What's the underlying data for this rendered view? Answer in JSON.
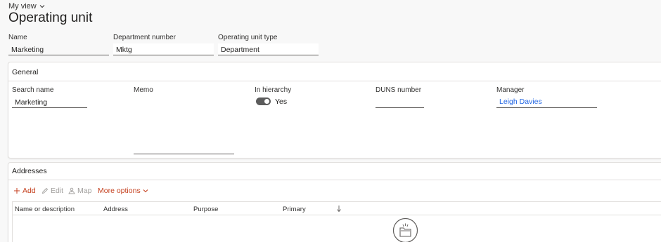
{
  "header": {
    "my_view_label": "My view",
    "title": "Operating unit"
  },
  "fields": {
    "name": {
      "label": "Name",
      "value": "Marketing"
    },
    "department_number": {
      "label": "Department number",
      "value": "Mktg"
    },
    "operating_unit_type": {
      "label": "Operating unit type",
      "value": "Department"
    }
  },
  "general": {
    "title": "General",
    "search_name": {
      "label": "Search name",
      "value": "Marketing"
    },
    "memo": {
      "label": "Memo",
      "value": ""
    },
    "in_hierarchy": {
      "label": "In hierarchy",
      "value": "Yes",
      "on": true
    },
    "duns_number": {
      "label": "DUNS number",
      "value": ""
    },
    "manager": {
      "label": "Manager",
      "value": "Leigh Davies"
    }
  },
  "addresses": {
    "title": "Addresses",
    "toolbar": {
      "add_label": "Add",
      "edit_label": "Edit",
      "map_label": "Map",
      "more_label": "More options"
    },
    "columns": [
      "Name or description",
      "Address",
      "Purpose",
      "Primary"
    ]
  },
  "colors": {
    "accent_red": "#c43e1c",
    "link_blue": "#2266e3",
    "toggle_on": "#5c5c5c"
  },
  "icons": [
    "chevron-down-icon",
    "plus-icon",
    "edit-icon",
    "map-icon",
    "sort-down-arrow-icon",
    "empty-folder-icon"
  ]
}
